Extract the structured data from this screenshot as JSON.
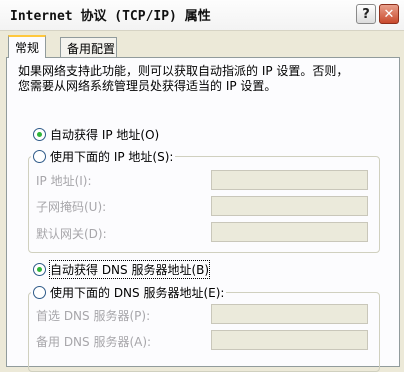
{
  "window": {
    "title": "Internet 协议 (TCP/IP) 属性",
    "help_glyph": "?",
    "close_glyph": "✕"
  },
  "tabs": [
    {
      "label": "常规",
      "active": true
    },
    {
      "label": "备用配置",
      "active": false
    }
  ],
  "description": [
    "如果网络支持此功能，则可以获取自动指派的 IP 设置。否则，",
    "您需要从网络系统管理员处获得适当的 IP 设置。"
  ],
  "ip_section": {
    "auto_label": "自动获得 IP 地址(O)",
    "manual_label": "使用下面的 IP 地址(S):",
    "auto_selected": true,
    "fields": [
      {
        "label": "IP 地址(I):",
        "value": ""
      },
      {
        "label": "子网掩码(U):",
        "value": ""
      },
      {
        "label": "默认网关(D):",
        "value": ""
      }
    ]
  },
  "dns_section": {
    "auto_label": "自动获得 DNS 服务器地址(B)",
    "manual_label": "使用下面的 DNS 服务器地址(E):",
    "auto_selected": true,
    "fields": [
      {
        "label": "首选 DNS 服务器(P):",
        "value": ""
      },
      {
        "label": "备用 DNS 服务器(A):",
        "value": ""
      }
    ]
  },
  "colors": {
    "window_bg": "#ece9d8",
    "active_tab_accent": "#ffc83c",
    "radio_dot": "#2fb53b",
    "disabled_text": "#a7a6aa"
  }
}
